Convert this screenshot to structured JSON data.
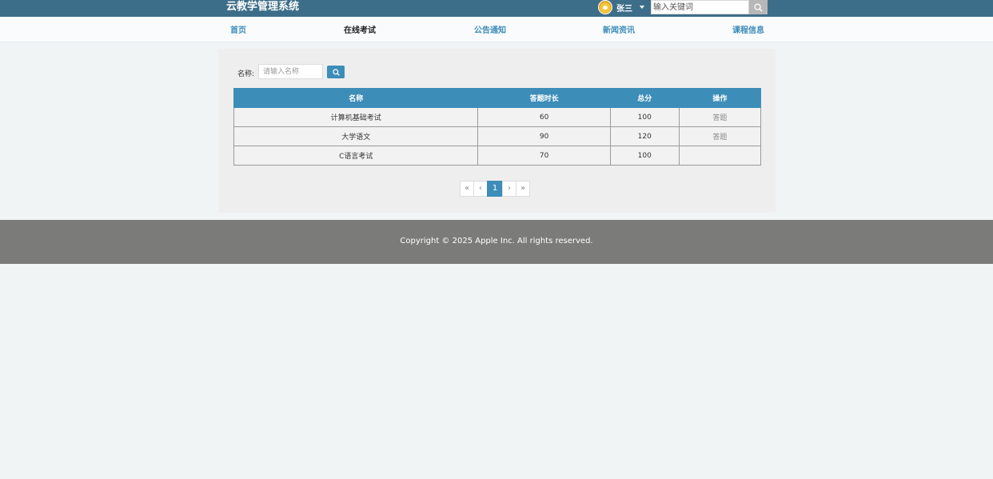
{
  "header": {
    "brand": "云教学管理系统",
    "user_name": "张三",
    "search_placeholder": "输入关键词"
  },
  "nav": {
    "items": [
      {
        "label": "首页",
        "active": false
      },
      {
        "label": "在线考试",
        "active": true
      },
      {
        "label": "公告通知",
        "active": false
      },
      {
        "label": "新闻资讯",
        "active": false
      },
      {
        "label": "课程信息",
        "active": false
      }
    ]
  },
  "filter": {
    "label": "名称:",
    "placeholder": "请输入名称"
  },
  "table": {
    "columns": [
      "名称",
      "答题时长",
      "总分",
      "操作"
    ],
    "rows": [
      {
        "name": "计算机基础考试",
        "duration": "60",
        "score": "100",
        "action": "答题"
      },
      {
        "name": "大学语文",
        "duration": "90",
        "score": "120",
        "action": "答题"
      },
      {
        "name": "C语言考试",
        "duration": "70",
        "score": "100",
        "action": ""
      }
    ]
  },
  "pagination": {
    "first": "«",
    "prev": "‹",
    "current": "1",
    "next": "›",
    "last": "»"
  },
  "footer": {
    "copyright": "Copyright © 2025 Apple Inc. All rights reserved."
  },
  "colors": {
    "topbar": "#3d6e89",
    "accent": "#3d8db9",
    "footer": "#7b7c79"
  }
}
